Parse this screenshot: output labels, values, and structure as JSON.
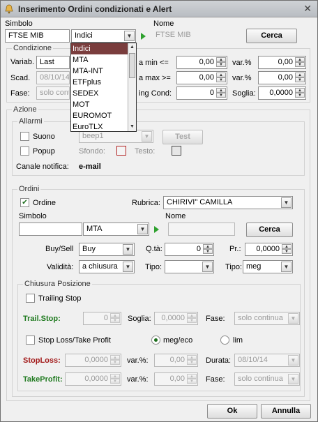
{
  "window": {
    "title": "Inserimento Ordini condizionati e Alert",
    "close_glyph": "✕"
  },
  "top": {
    "simbolo_label": "Simbolo",
    "simbolo_value": "FTSE MIB",
    "market_value": "Indici",
    "nome_label": "Nome",
    "nome_value": "FTSE MIB",
    "cerca_label": "Cerca"
  },
  "dropdown": {
    "options": [
      "Indici",
      "MTA",
      "MTA-INT",
      "ETFplus",
      "SEDEX",
      "MOT",
      "EUROMOT",
      "EuroTLX"
    ],
    "selected": "Indici"
  },
  "condizione": {
    "title": "Condizione",
    "variab_label": "Variab.",
    "variab_value": "Last",
    "scad_label": "Scad.",
    "scad_value": "08/10/14",
    "fase_label": "Fase:",
    "fase_value": "solo continua",
    "min_label": "a min <=",
    "min_value": "0,00",
    "max_label": "a max >=",
    "max_value": "0,00",
    "ing_label": "ing Cond:",
    "ing_value": "0",
    "var1_label": "var.%",
    "var1_value": "0,00",
    "var2_label": "var.%",
    "var2_value": "0,00",
    "soglia_label": "Soglia:",
    "soglia_value": "0,0000"
  },
  "azione": {
    "title": "Azione",
    "allarmi_title": "Allarmi",
    "suono_label": "Suono",
    "suono_value": "beep1",
    "test_label": "Test",
    "popup_label": "Popup",
    "sfondo_label": "Sfondo:",
    "testo_label": "Testo:",
    "canale_label": "Canale notifica:",
    "canale_value": "e-mail"
  },
  "ordini": {
    "title": "Ordini",
    "ordine_label": "Ordine",
    "ordine_checked": true,
    "rubrica_label": "Rubrica:",
    "rubrica_value": "CHIRIVI\" CAMILLA",
    "simbolo_label": "Simbolo",
    "simbolo_value": "",
    "market_value": "MTA",
    "nome_label": "Nome",
    "nome_value": "",
    "cerca_label": "Cerca",
    "buysell_label": "Buy/Sell",
    "buysell_value": "Buy",
    "qta_label": "Q.tà:",
    "qta_value": "0",
    "pr_label": "Pr.:",
    "pr_value": "0,0000",
    "validita_label": "Validità:",
    "validita_value": "a chiusura",
    "tipo1_label": "Tipo:",
    "tipo1_value": "",
    "tipo2_label": "Tipo:",
    "tipo2_value": "meg"
  },
  "chiusura": {
    "title": "Chiusura Posizione",
    "trailing_label": "Trailing Stop",
    "trailstop_label": "Trail.Stop:",
    "trailstop_value": "0",
    "soglia_label": "Soglia:",
    "soglia_value": "0,0000",
    "fase_label": "Fase:",
    "fase_value": "solo continua",
    "sltp_label": "Stop Loss/Take Profit",
    "megeco_label": "meg/eco",
    "lim_label": "lim",
    "stoploss_label": "StopLoss:",
    "stoploss_value": "0,0000",
    "var1_label": "var.%:",
    "var1_value": "0,00",
    "durata_label": "Durata:",
    "durata_value": "08/10/14",
    "takeprofit_label": "TakeProfit:",
    "takeprofit_value": "0,0000",
    "var2_label": "var.%:",
    "var2_value": "0,00",
    "fase2_label": "Fase:",
    "fase2_value": "solo continua"
  },
  "footer": {
    "ok_label": "Ok",
    "annulla_label": "Annulla"
  },
  "colors": {
    "selected_item": "#7a3d3d",
    "sfondo_swatch": "#b22222",
    "testo_swatch": "#555555"
  }
}
